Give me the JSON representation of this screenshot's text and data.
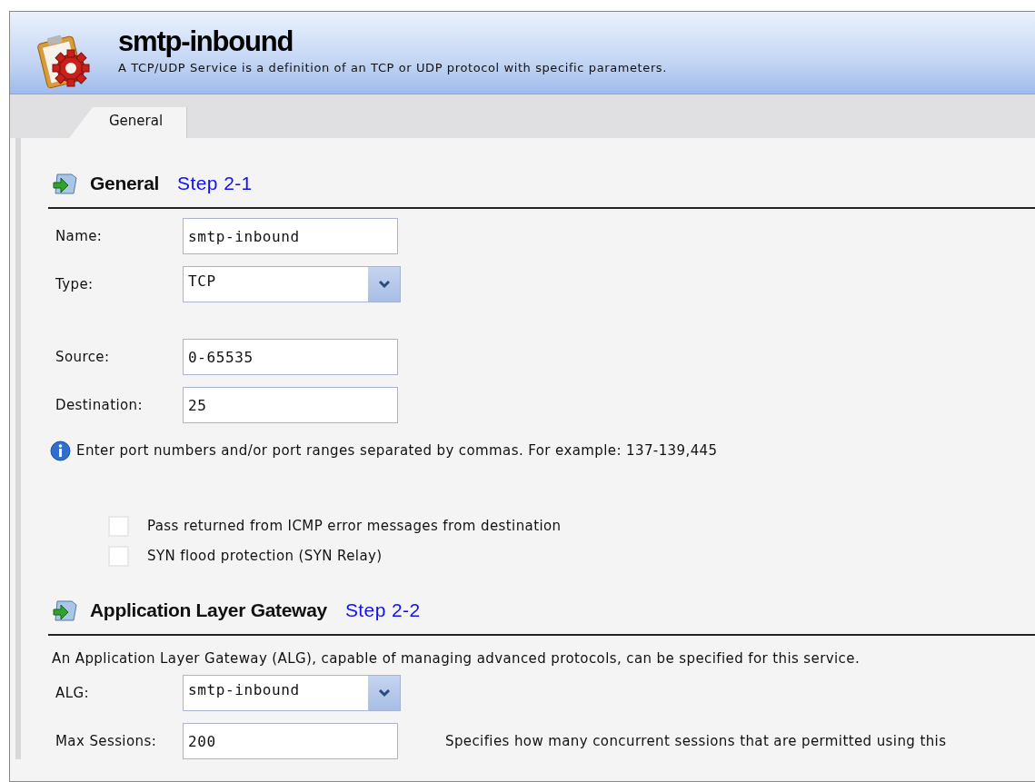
{
  "header": {
    "title": "smtp-inbound",
    "description": "A TCP/UDP Service is a definition of an TCP or UDP protocol with specific parameters."
  },
  "tabs": [
    {
      "label": "General",
      "selected": true
    }
  ],
  "sections": [
    {
      "title": "General",
      "step": "Step 2-1",
      "groups": [
        [
          {
            "kind": "text-field",
            "label": "Name:",
            "value": "smtp-inbound"
          },
          {
            "kind": "select",
            "label": "Type:",
            "value": "TCP"
          }
        ],
        [
          {
            "kind": "text-field",
            "label": "Source:",
            "value": "0-65535"
          },
          {
            "kind": "text-field",
            "label": "Destination:",
            "value": "25"
          },
          {
            "kind": "info",
            "text": "Enter port numbers and/or port ranges separated by commas. For example: 137-139,445"
          }
        ],
        [
          {
            "kind": "checkbox",
            "label": "Pass returned from ICMP error messages from destination",
            "checked": false
          },
          {
            "kind": "checkbox",
            "label": "SYN flood protection (SYN Relay)",
            "checked": false
          }
        ]
      ]
    },
    {
      "title": "Application Layer Gateway",
      "step": "Step 2-2",
      "groups": [
        [
          {
            "kind": "note",
            "text": "An Application Layer Gateway (ALG), capable of managing advanced protocols, can be specified for this service."
          },
          {
            "kind": "select",
            "label": "ALG:",
            "value": "smtp-inbound"
          },
          {
            "kind": "text-field",
            "label": "Max Sessions:",
            "value": "200",
            "hint": "Specifies how many concurrent sessions that are permitted using this"
          }
        ]
      ]
    }
  ]
}
